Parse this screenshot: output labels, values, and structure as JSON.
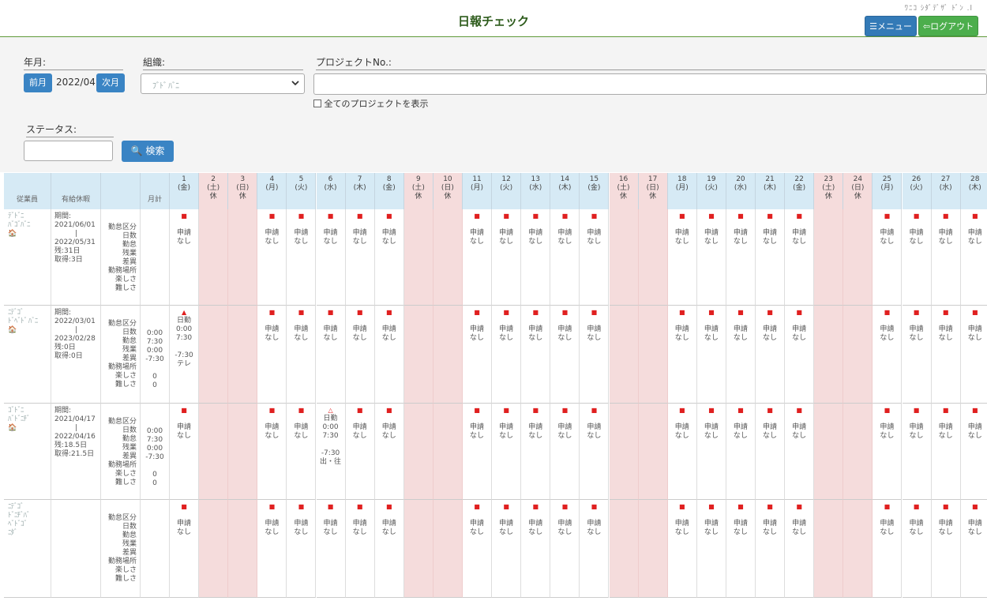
{
  "header": {
    "title": "日報チェック",
    "user_text": "ﾜﾆｺ ｼﾀﾞﾃﾞｻﾞ ﾄﾞﾝ .l",
    "menu_label": "メニュー",
    "logout_label": "ログアウト"
  },
  "filters": {
    "yearmonth_label": "年月:",
    "prev_label": "前月",
    "yearmonth_value": "2022/04",
    "next_label": "次月",
    "org_label": "組織:",
    "org_value": "ﾌﾞﾄﾞ ﾊﾞﾆ",
    "project_label": "プロジェクトNo.:",
    "project_value": "",
    "show_all_label": "全てのプロジェクトを表示",
    "status_label": "ステータス:",
    "status_value": "",
    "search_label": "検索"
  },
  "table": {
    "headers": [
      "従業員",
      "有給休暇",
      "",
      "月計"
    ],
    "days": [
      {
        "d": "1",
        "w": "(金)",
        "off": false
      },
      {
        "d": "2",
        "w": "(土)",
        "off": true
      },
      {
        "d": "3",
        "w": "(日)",
        "off": true
      },
      {
        "d": "4",
        "w": "(月)",
        "off": false
      },
      {
        "d": "5",
        "w": "(火)",
        "off": false
      },
      {
        "d": "6",
        "w": "(水)",
        "off": false
      },
      {
        "d": "7",
        "w": "(木)",
        "off": false
      },
      {
        "d": "8",
        "w": "(金)",
        "off": false
      },
      {
        "d": "9",
        "w": "(土)",
        "off": true
      },
      {
        "d": "10",
        "w": "(日)",
        "off": true
      },
      {
        "d": "11",
        "w": "(月)",
        "off": false
      },
      {
        "d": "12",
        "w": "(火)",
        "off": false
      },
      {
        "d": "13",
        "w": "(水)",
        "off": false
      },
      {
        "d": "14",
        "w": "(木)",
        "off": false
      },
      {
        "d": "15",
        "w": "(金)",
        "off": false
      },
      {
        "d": "16",
        "w": "(土)",
        "off": true
      },
      {
        "d": "17",
        "w": "(日)",
        "off": true
      },
      {
        "d": "18",
        "w": "(月)",
        "off": false
      },
      {
        "d": "19",
        "w": "(火)",
        "off": false
      },
      {
        "d": "20",
        "w": "(水)",
        "off": false
      },
      {
        "d": "21",
        "w": "(木)",
        "off": false
      },
      {
        "d": "22",
        "w": "(金)",
        "off": false
      },
      {
        "d": "23",
        "w": "(土)",
        "off": true
      },
      {
        "d": "24",
        "w": "(日)",
        "off": true
      },
      {
        "d": "25",
        "w": "(月)",
        "off": false
      },
      {
        "d": "26",
        "w": "(火)",
        "off": false
      },
      {
        "d": "27",
        "w": "(水)",
        "off": false
      },
      {
        "d": "28",
        "w": "(木)",
        "off": false
      }
    ],
    "holiday_text": "休",
    "row_labels": [
      "勤怠区分",
      "日数",
      "勤怠",
      "残業",
      "差異",
      "勤務場所",
      "楽しさ",
      "難しさ"
    ],
    "default_entry": [
      "申請",
      "なし"
    ],
    "rows": [
      {
        "name": [
          "ﾃﾞﾄﾞﾆ",
          "ﾊﾞｺﾞﾊﾞﾆ"
        ],
        "leave": [
          "期間:",
          "2021/06/01",
          "|",
          "2022/05/31",
          "残:31日",
          "取得:3日"
        ],
        "totals": [],
        "special": {}
      },
      {
        "name": [
          "ﾆﾃﾞｺﾞ",
          "ﾄﾞﾍﾞﾄﾞ ﾊﾞﾆ"
        ],
        "leave": [
          "期間:",
          "2022/03/01",
          "|",
          "2023/02/28",
          "残:0日",
          "取得:0日"
        ],
        "totals": [
          "0:00",
          "7:30",
          "0:00",
          "-7:30",
          "",
          "0",
          "0"
        ],
        "special": {
          "0": {
            "mark": "▲",
            "lines": [
              "日勤",
              "0:00",
              "7:30",
              "",
              "-7:30",
              "テレ"
            ]
          }
        }
      },
      {
        "name": [
          "ｺﾞﾄﾞﾆ",
          "ﾊﾞﾄﾞﾆﾁﾞ"
        ],
        "leave": [
          "期間:",
          "2021/04/17",
          "|",
          "2022/04/16",
          "残:18.5日",
          "取得:21.5日"
        ],
        "totals": [
          "0:00",
          "7:30",
          "0:00",
          "-7:30",
          "",
          "0",
          "0"
        ],
        "special": {
          "5": {
            "mark": "△",
            "lines": [
              "日勤",
              "0:00",
              "7:30",
              "",
              "-7:30",
              "出・往"
            ]
          }
        }
      },
      {
        "name": [
          "ﾆﾃﾞｺﾞ",
          "ﾄﾞﾆﾁﾞﾊﾞ",
          "ﾍﾞﾄﾞｺﾞ",
          "ﾆﾀﾞ"
        ],
        "leave": [],
        "totals": [],
        "special": {}
      }
    ]
  },
  "colors": {
    "accent": "#337ab7",
    "green": "#4cae4c",
    "weekend": "#f5dcdc",
    "header": "#d6eaf5"
  }
}
